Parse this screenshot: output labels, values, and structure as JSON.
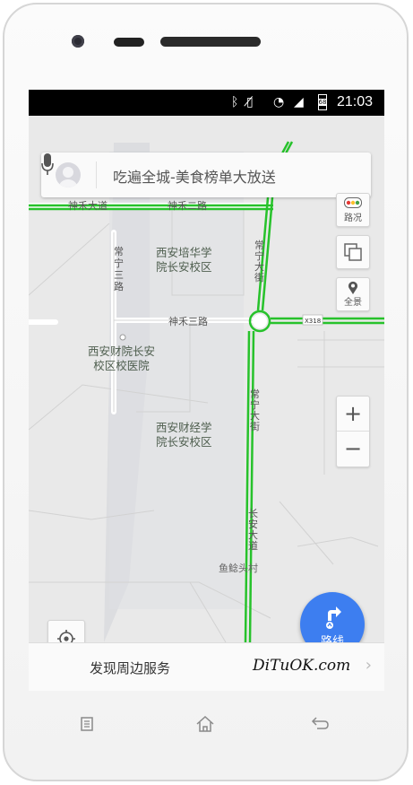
{
  "status_bar": {
    "time": "21:03",
    "icons": [
      "bluetooth-icon",
      "vibrate-icon",
      "wifi-icon",
      "signal-icon",
      "battery-icon"
    ],
    "battery_level": "68"
  },
  "search": {
    "placeholder": "吃遍全城-美食榜单大放送"
  },
  "controls": {
    "traffic_label": "路况",
    "panorama_label": "全景",
    "zoom_in": "+",
    "zoom_out": "−"
  },
  "route_button": {
    "label": "路线"
  },
  "bottom_bar": {
    "nearby_label": "发现周边服务",
    "watermark": "DiTuOK.com",
    "chevron": "›"
  },
  "map": {
    "roads": {
      "shenhe_avenue": "神禾大道",
      "shenhe_2nd_road": "神禾二路",
      "shenhe_3rd_road": "神禾三路",
      "changning_3rd_road": [
        "常",
        "宁",
        "三",
        "路"
      ],
      "changning_avenue_1": [
        "常",
        "宁",
        "大",
        "街"
      ],
      "changning_avenue_2": [
        "常",
        "宁",
        "大",
        "街"
      ],
      "changan_avenue": [
        "长",
        "安",
        "大",
        "道"
      ],
      "x318": "X318"
    },
    "places": {
      "peihua": [
        "西安培华学",
        "院长安校区"
      ],
      "caiyuan_hospital": [
        "西安财院长安",
        "校区校医院"
      ],
      "caijing": [
        "西安财经学",
        "院长安校区"
      ],
      "yuwei_village": "鱼鲶头村"
    },
    "colors": {
      "traffic_green": "#27c22b",
      "route_blue": "#3d7ef0",
      "map_bg": "#e9e9e9"
    }
  }
}
